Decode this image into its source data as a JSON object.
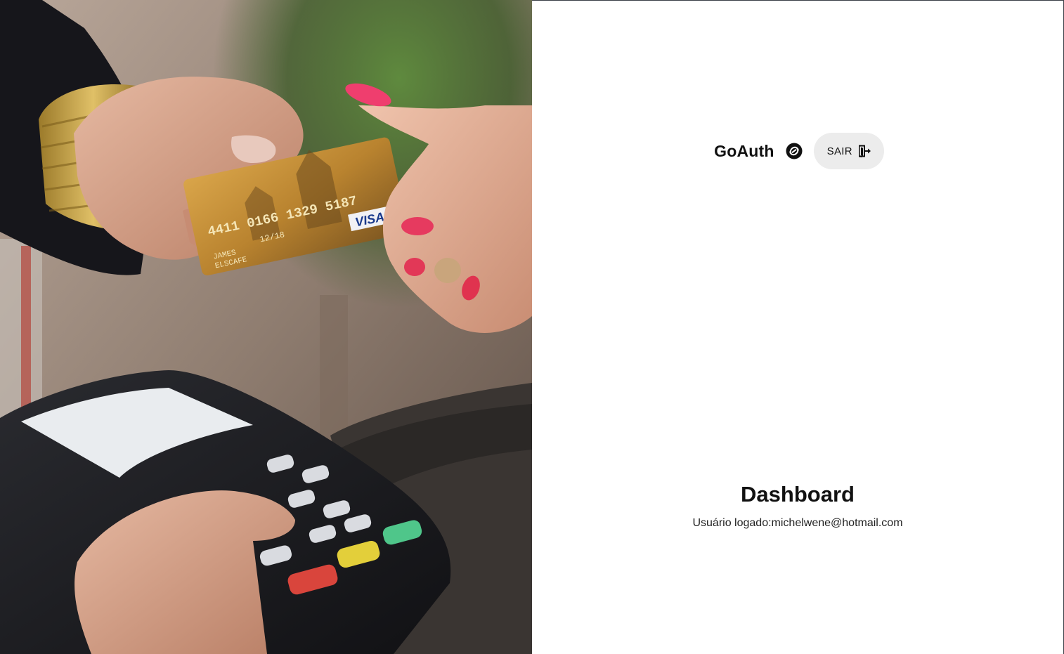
{
  "header": {
    "brand_name": "GoAuth",
    "brand_icon": "at-sign-swirl-icon",
    "logout_label": "SAIR",
    "logout_icon": "logout-icon"
  },
  "main": {
    "title": "Dashboard",
    "user_prefix": "Usuário logado:",
    "user_email": "michelwene@hotmail.com"
  },
  "hero_image": {
    "description_icon": "payment-card-photo",
    "card_number": "4411 0166 1329 5187",
    "card_expiry": "12/18",
    "card_holder_line1": "JAMES",
    "card_holder_line2": "ELSCAFE",
    "card_brand": "VISA"
  },
  "colors": {
    "text": "#111111",
    "button_bg": "#ececec",
    "panel_border": "#3a3f47"
  }
}
